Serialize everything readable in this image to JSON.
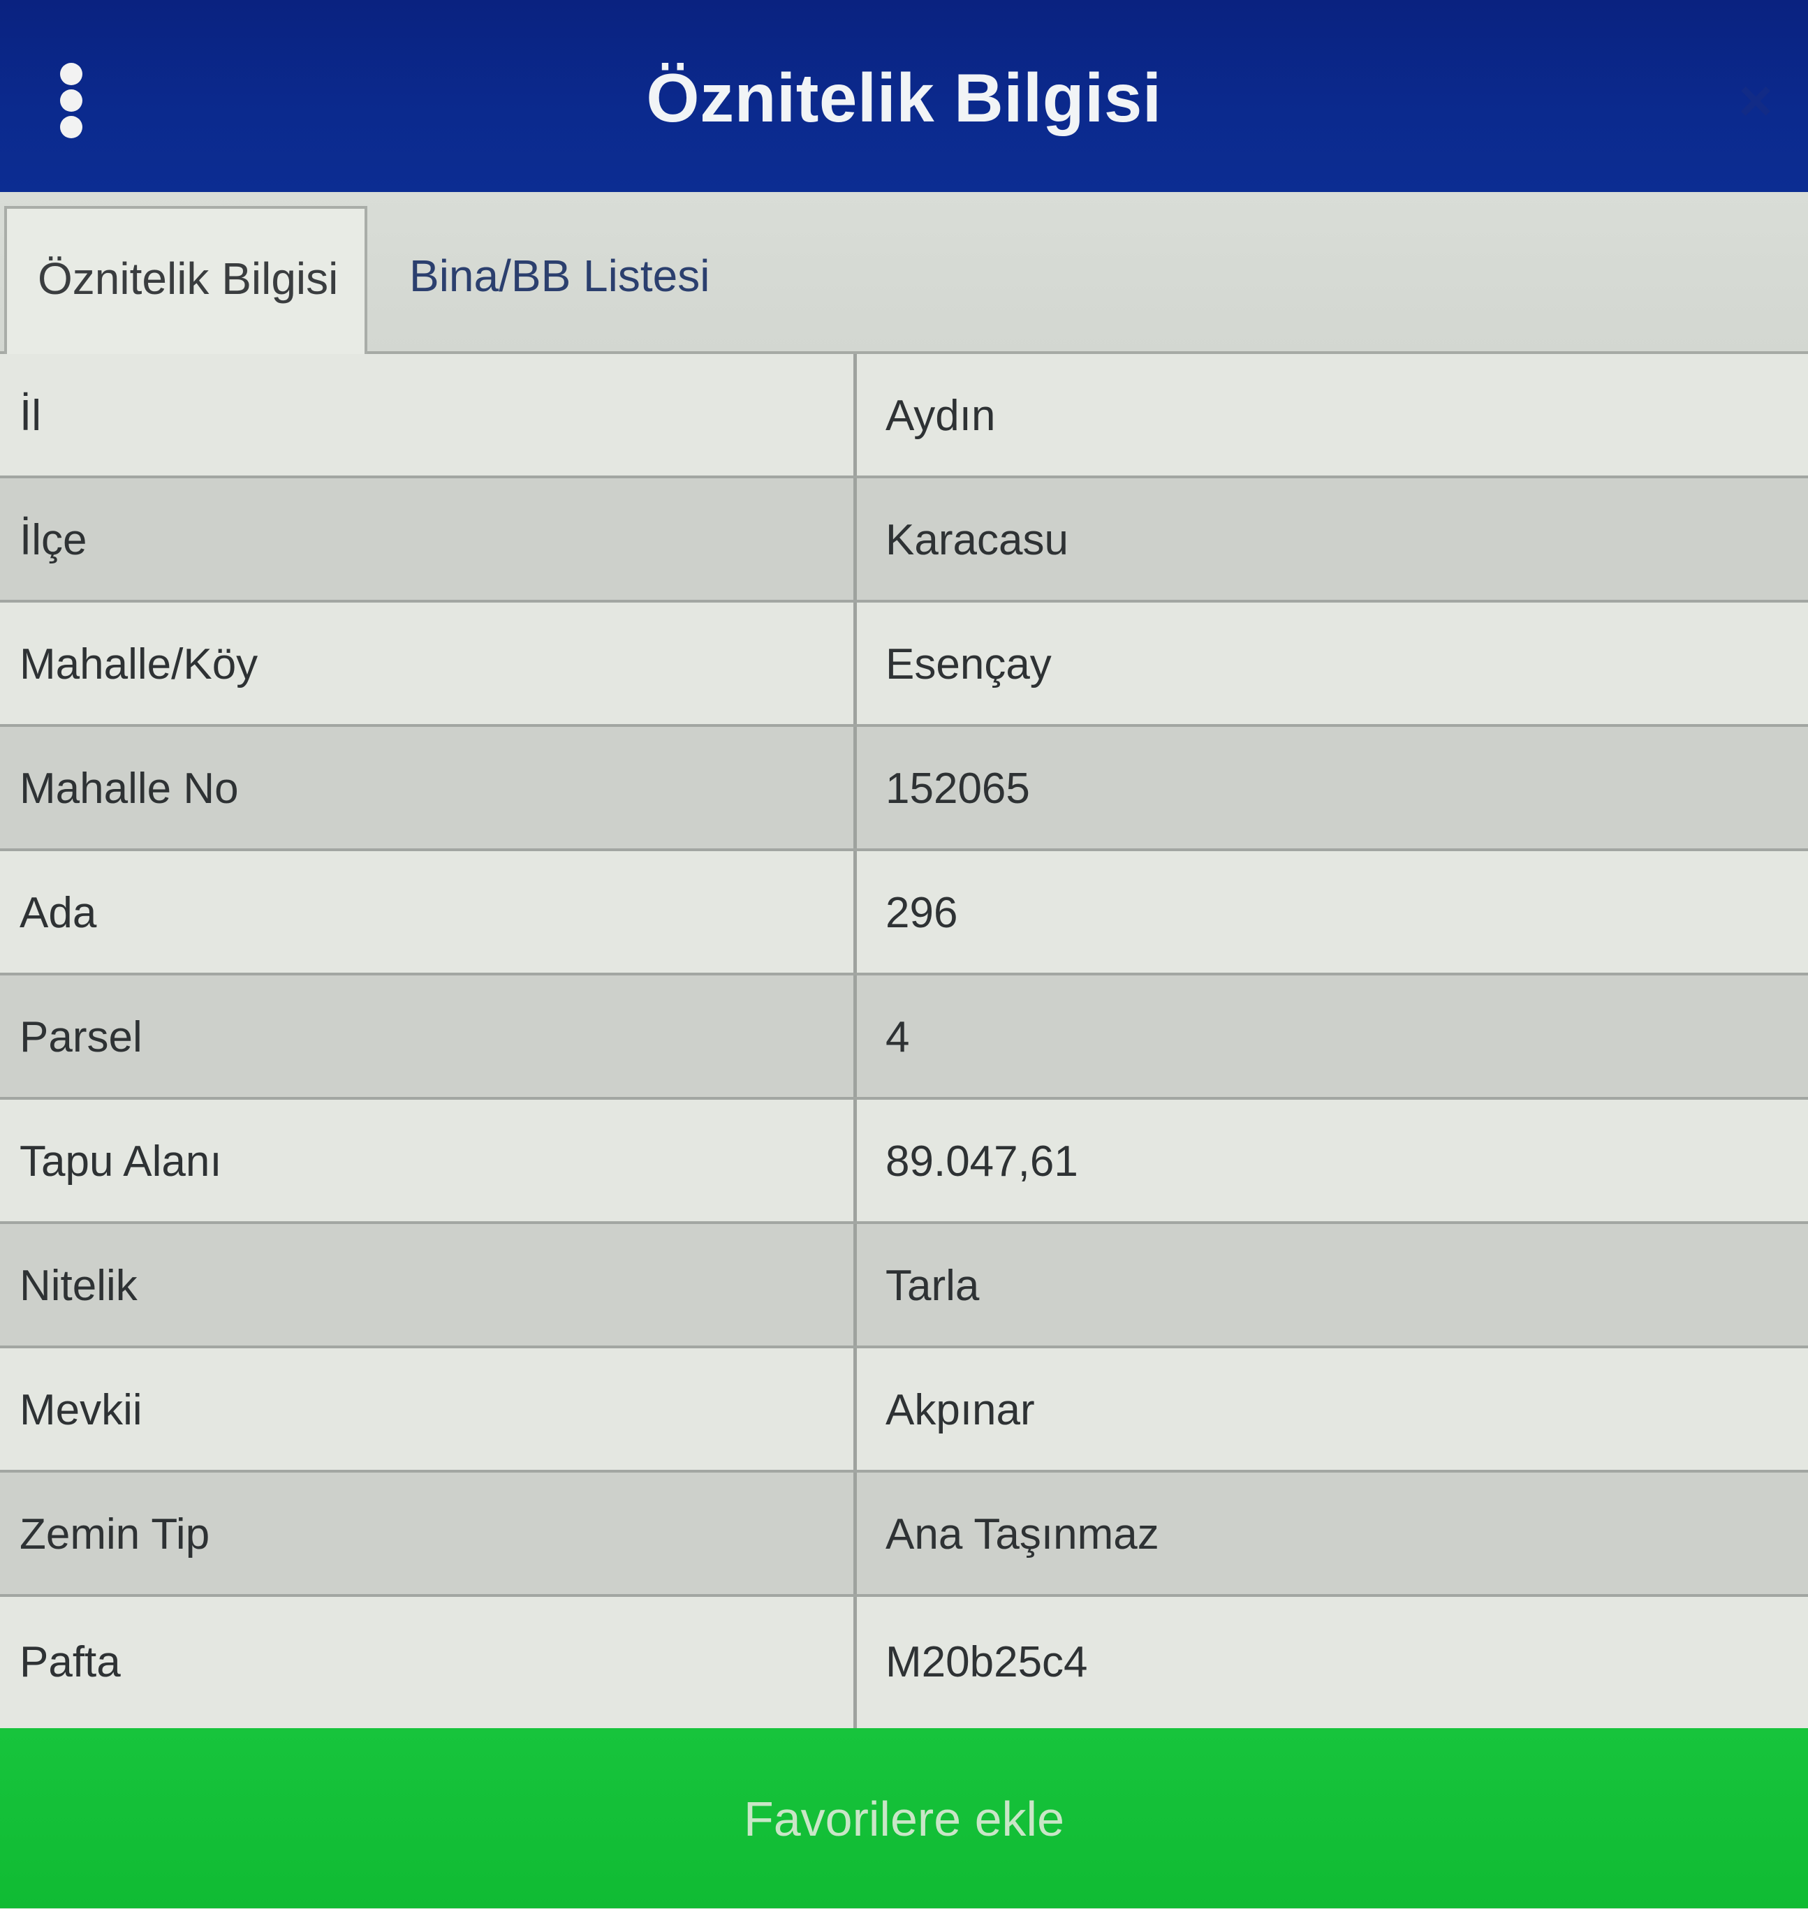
{
  "header": {
    "title": "Öznitelik Bilgisi",
    "close_label": "×"
  },
  "tabs": [
    {
      "label": "Öznitelik Bilgisi",
      "active": true
    },
    {
      "label": "Bina/BB Listesi",
      "active": false
    }
  ],
  "rows": [
    {
      "label": "İl",
      "value": "Aydın"
    },
    {
      "label": "İlçe",
      "value": "Karacasu"
    },
    {
      "label": "Mahalle/Köy",
      "value": "Esençay"
    },
    {
      "label": "Mahalle No",
      "value": "152065"
    },
    {
      "label": "Ada",
      "value": "296"
    },
    {
      "label": "Parsel",
      "value": "4"
    },
    {
      "label": "Tapu Alanı",
      "value": "89.047,61"
    },
    {
      "label": "Nitelik",
      "value": "Tarla"
    },
    {
      "label": "Mevkii",
      "value": "Akpınar"
    },
    {
      "label": "Zemin Tip",
      "value": "Ana Taşınmaz"
    },
    {
      "label": "Pafta",
      "value": "M20b25c4"
    }
  ],
  "footer": {
    "favorite_label": "Favorilere ekle"
  },
  "colors": {
    "header_bg": "#0b2a8e",
    "tab_bg": "#d9ddd7",
    "row_light": "#e4e7e1",
    "row_dark": "#cdd0cb",
    "button_bg": "#15c13a"
  },
  "icons": {
    "menu": "vertical-ellipsis-icon",
    "close": "close-icon"
  }
}
